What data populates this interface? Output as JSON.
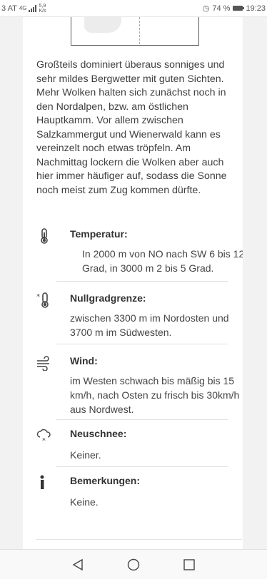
{
  "status": {
    "carrier": "3 AT",
    "network": "4G",
    "speed": "5,9",
    "speed_unit": "K/s",
    "battery": "74 %",
    "time": "19:23"
  },
  "forecast": {
    "description": "Großteils dominiert überaus sonniges und sehr mildes Bergwetter mit guten Sichten. Mehr Wolken halten sich zunächst noch in den Nordalpen, bzw. am östlichen Hauptkamm. Vor allem zwischen Salzkammergut und Wienerwald kann es vereinzelt noch etwas tröpfeln. Am Nachmittag lockern die Wolken aber auch hier immer häufiger auf, sodass die Sonne noch meist zum Zug kommen dürfte.",
    "sections": [
      {
        "icon": "thermometer-icon",
        "title": "Temperatur:",
        "text": "In 2000 m von NO nach SW 6 bis 12 Grad, in 3000 m 2 bis 5 Grad."
      },
      {
        "icon": "freezing-level-icon",
        "title": "Nullgradgrenze:",
        "text": "zwischen 3300 m im Nordosten und 3700 m im Südwesten."
      },
      {
        "icon": "wind-icon",
        "title": "Wind:",
        "text": "im Westen schwach bis mäßig bis 15 km/h, nach Osten zu frisch bis 30km/h aus Nordwest."
      },
      {
        "icon": "snow-cloud-icon",
        "title": "Neuschnee:",
        "text": "Keiner."
      },
      {
        "icon": "info-icon",
        "title": "Bemerkungen:",
        "text": "Keine."
      }
    ]
  },
  "nav": [
    "back",
    "home",
    "recents"
  ]
}
